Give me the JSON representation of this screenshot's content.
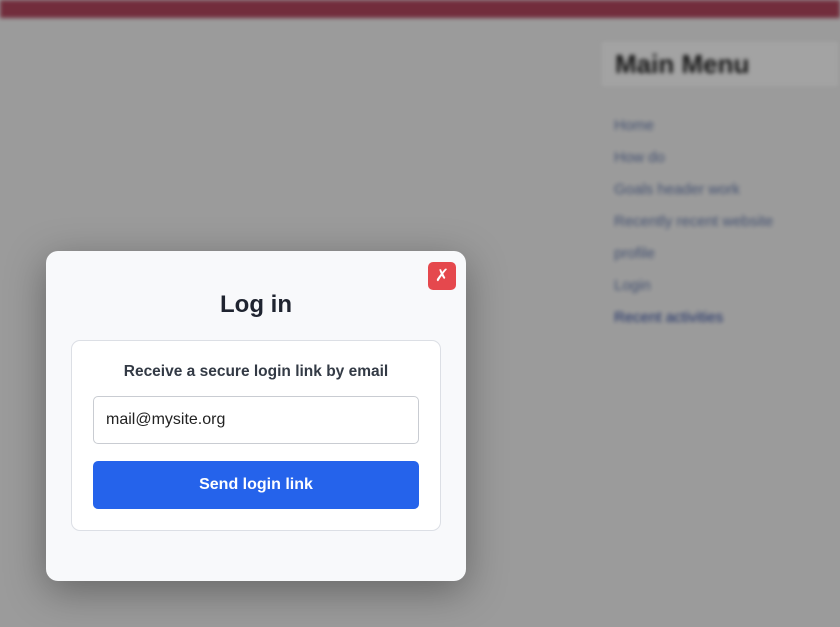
{
  "background": {
    "menu_title": "Main Menu",
    "menu_items": [
      "Home",
      "How do",
      "Goals header work",
      "Recently recent website",
      "profile",
      "Login",
      "Recent activities"
    ]
  },
  "modal": {
    "close_glyph": "✗",
    "title": "Log in",
    "card_label": "Receive a secure login link by email",
    "email_value": "mail@mysite.org",
    "send_label": "Send login link"
  },
  "colors": {
    "topbar": "#b3475f",
    "close_button": "#e5484d",
    "primary_button": "#2563eb"
  }
}
